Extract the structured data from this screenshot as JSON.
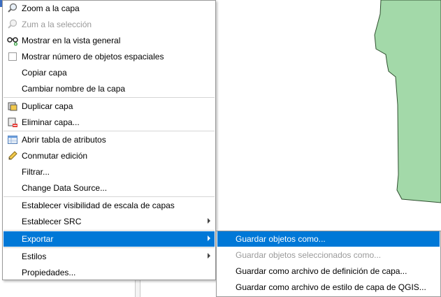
{
  "colors": {
    "highlight": "#0078d7",
    "map_fill": "#a3d9a9",
    "disabled_text": "#9a9a9a"
  },
  "context_menu": {
    "items": [
      {
        "label": "Zoom a la capa",
        "icon": "zoom-layer-icon"
      },
      {
        "label": "Zum a la selección",
        "icon": "zoom-selection-icon",
        "disabled": true
      },
      {
        "label": "Mostrar en la vista general",
        "icon": "overview-glasses-icon"
      },
      {
        "label": "Mostrar número de objetos espaciales",
        "icon": "checkbox-icon"
      },
      {
        "label": "Copiar capa"
      },
      {
        "label": "Cambiar nombre de la capa"
      },
      {
        "label": "Duplicar capa",
        "icon": "duplicate-layer-icon"
      },
      {
        "label": "Eliminar capa...",
        "icon": "remove-layer-icon"
      },
      {
        "label": "Abrir tabla de atributos",
        "icon": "attribute-table-icon"
      },
      {
        "label": "Conmutar edición",
        "icon": "pencil-icon"
      },
      {
        "label": "Filtrar..."
      },
      {
        "label": "Change Data Source..."
      },
      {
        "label": "Establecer visibilidad de escala de capas"
      },
      {
        "label": "Establecer SRC",
        "submenu": true
      },
      {
        "label": "Exportar",
        "submenu": true,
        "highlighted": true
      },
      {
        "label": "Estilos",
        "submenu": true
      },
      {
        "label": "Propiedades..."
      }
    ]
  },
  "export_submenu": {
    "items": [
      {
        "label": "Guardar objetos como...",
        "highlighted": true
      },
      {
        "label": "Guardar objetos seleccionados como...",
        "disabled": true
      },
      {
        "label": "Guardar como archivo de definición de capa..."
      },
      {
        "label": "Guardar como archivo de estilo de capa de QGIS..."
      }
    ]
  }
}
